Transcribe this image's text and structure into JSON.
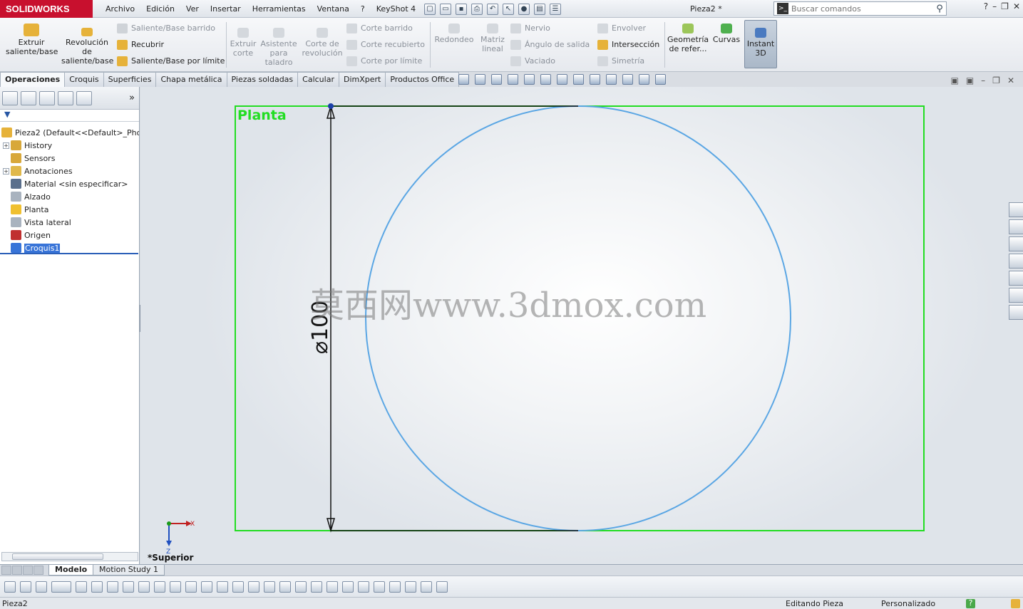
{
  "app": {
    "logo": "SOLIDWORKS",
    "doc_title": "Pieza2 *"
  },
  "menu": [
    "Archivo",
    "Edición",
    "Ver",
    "Insertar",
    "Herramientas",
    "Ventana",
    "?",
    "KeyShot 4"
  ],
  "search": {
    "placeholder": "Buscar comandos"
  },
  "ribbon": {
    "extrude": "Extruir\nsaliente/base",
    "revolve": "Revolución\nde\nsaliente/base",
    "sweep_boss": "Saliente/Base barrido",
    "loft": "Recubrir",
    "boundary_boss": "Saliente/Base por límite",
    "extrude_cut": "Extruir\ncorte",
    "hole_wizard": "Asistente\npara\ntaladro",
    "revolve_cut": "Corte de\nrevolución",
    "sweep_cut": "Corte barrido",
    "loft_cut": "Corte recubierto",
    "boundary_cut": "Corte por límite",
    "fillet": "Redondeo",
    "linear_pattern": "Matriz\nlineal",
    "rib": "Nervio",
    "draft": "Ángulo de salida",
    "shell": "Vaciado",
    "wrap": "Envolver",
    "intersect": "Intersección",
    "mirror": "Simetría",
    "ref_geometry": "Geometría\nde refer...",
    "curves": "Curvas",
    "instant3d": "Instant\n3D"
  },
  "tabs": [
    "Operaciones",
    "Croquis",
    "Superficies",
    "Chapa metálica",
    "Piezas soldadas",
    "Calcular",
    "DimXpert",
    "Productos Office"
  ],
  "tree": {
    "root": "Pieza2  (Default<<Default>_Phot",
    "items": [
      {
        "label": "History",
        "expand": true,
        "color": "#d8a83a"
      },
      {
        "label": "Sensors",
        "expand": false,
        "color": "#d8a83a"
      },
      {
        "label": "Anotaciones",
        "expand": true,
        "color": "#e0b84a"
      },
      {
        "label": "Material <sin especificar>",
        "expand": false,
        "color": "#5a6f8c"
      },
      {
        "label": "Alzado",
        "expand": false,
        "color": "#a9b3bf"
      },
      {
        "label": "Planta",
        "expand": false,
        "color": "#f0c030"
      },
      {
        "label": "Vista lateral",
        "expand": false,
        "color": "#a9b3bf"
      },
      {
        "label": "Origen",
        "expand": false,
        "color": "#c03030"
      },
      {
        "label": "Croquis1",
        "expand": false,
        "color": "#3874d8",
        "selected": true
      }
    ]
  },
  "viewport": {
    "plane_label": "Planta",
    "dimension_text": "⌀100",
    "watermark": "莫西网www.3dmox.com",
    "view_label": "*Superior",
    "triad_x": "X",
    "triad_z": "Z",
    "colors": {
      "plane": "#22dd22",
      "circle": "#5aa6e4",
      "dimension": "#000000"
    }
  },
  "bottom_tabs": [
    "Modelo",
    "Motion Study 1"
  ],
  "status": {
    "left": "Pieza2",
    "mode": "Editando Pieza",
    "custom": "Personalizado",
    "help": "?"
  }
}
